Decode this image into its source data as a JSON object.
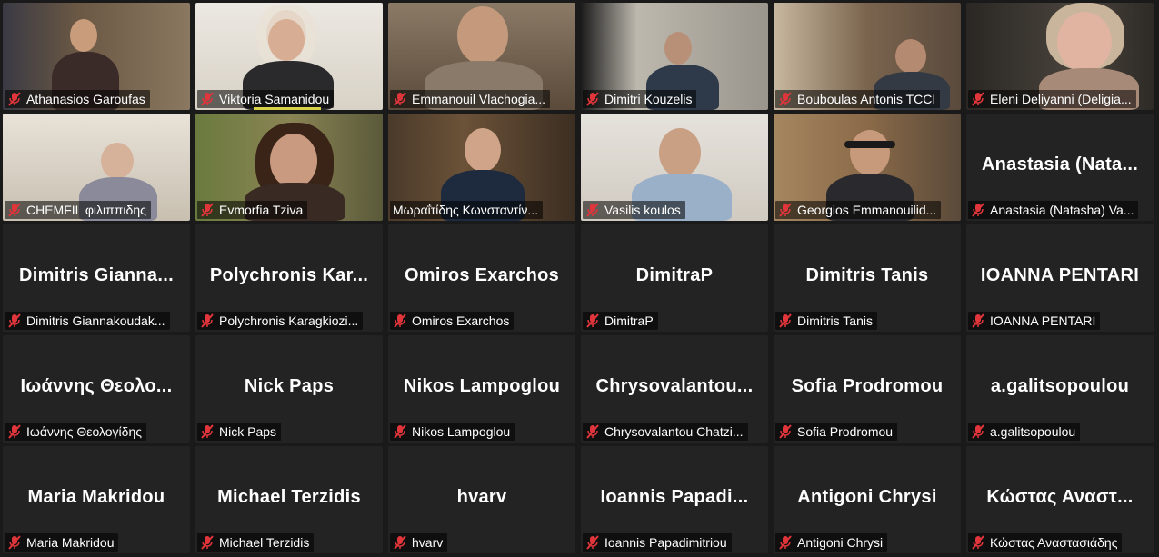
{
  "participants": [
    {
      "label": "Athanasios Garoufas",
      "video": true,
      "bg": "#5b4a3a"
    },
    {
      "label": "Viktoria Samanidou",
      "video": true,
      "bg": "#d9d4c8"
    },
    {
      "label": "Emmanouil Vlachogia...",
      "video": true,
      "bg": "#6f5a45"
    },
    {
      "label": "Dimitri Kouzelis",
      "video": true,
      "bg": "#a9a49c"
    },
    {
      "label": "Bouboulas Antonis TCCI",
      "video": true,
      "bg": "#7d6b57"
    },
    {
      "label": "Eleni Deliyanni (Deligia...",
      "video": true,
      "bg": "#3d3934"
    },
    {
      "label": "CHEMFIL φιλιππιδης",
      "video": true,
      "bg": "#cfc8ba"
    },
    {
      "label": "Evmorfia Tziva",
      "video": true,
      "bg": "#6b7a4a"
    },
    {
      "label": "Μωραΐτίδης Κωνσταντίν...",
      "video": true,
      "bg": "#4b3a2c",
      "active": true
    },
    {
      "label": "Vasilis koulos",
      "video": true,
      "bg": "#d8d3cb"
    },
    {
      "label": "Georgios Emmanouilid...",
      "video": true,
      "bg": "#8a7256"
    },
    {
      "label": "Anastasia (Natasha) Va...",
      "video": false,
      "name": "Anastasia  (Nata..."
    },
    {
      "label": "Dimitris Giannakoudak...",
      "video": false,
      "name": "Dimitris  Gianna..."
    },
    {
      "label": "Polychronis Karagkiozi...",
      "video": false,
      "name": "Polychronis  Kar..."
    },
    {
      "label": "Omiros Exarchos",
      "video": false,
      "name": "Omiros Exarchos"
    },
    {
      "label": "DimitraP",
      "video": false,
      "name": "DimitraP"
    },
    {
      "label": "Dimitris Tanis",
      "video": false,
      "name": "Dimitris Tanis"
    },
    {
      "label": "IOANNA PENTARI",
      "video": false,
      "name": "IOANNA PENTARI"
    },
    {
      "label": "Ιωάννης Θεολογίδης",
      "video": false,
      "name": "Ιωάννης Θεολο..."
    },
    {
      "label": "Nick Paps",
      "video": false,
      "name": "Nick Paps"
    },
    {
      "label": "Nikos Lampoglou",
      "video": false,
      "name": "Nikos Lampoglou"
    },
    {
      "label": "Chrysovalantou Chatzi...",
      "video": false,
      "name": "Chrysovalantou..."
    },
    {
      "label": "Sofia Prodromou",
      "video": false,
      "name": "Sofia Prodromou"
    },
    {
      "label": "a.galitsopoulou",
      "video": false,
      "name": "a.galitsopoulou"
    },
    {
      "label": "Maria Makridou",
      "video": false,
      "name": "Maria Makridou"
    },
    {
      "label": "Michael Terzidis",
      "video": false,
      "name": "Michael Terzidis"
    },
    {
      "label": "hvarv",
      "video": false,
      "name": "hvarv"
    },
    {
      "label": "Ioannis Papadimitriou",
      "video": false,
      "name": "Ioannis  Papadi..."
    },
    {
      "label": "Antigoni Chrysi",
      "video": false,
      "name": "Antigoni Chrysi"
    },
    {
      "label": "Κώστας Αναστασιάδης",
      "video": false,
      "name": "Κώστας Αναστ..."
    }
  ],
  "colors": {
    "muted_icon": "#e0353a",
    "active_outline": "#c9dc4e",
    "tile_bg": "#232323"
  },
  "icons": {
    "muted": "mic-muted-icon"
  }
}
